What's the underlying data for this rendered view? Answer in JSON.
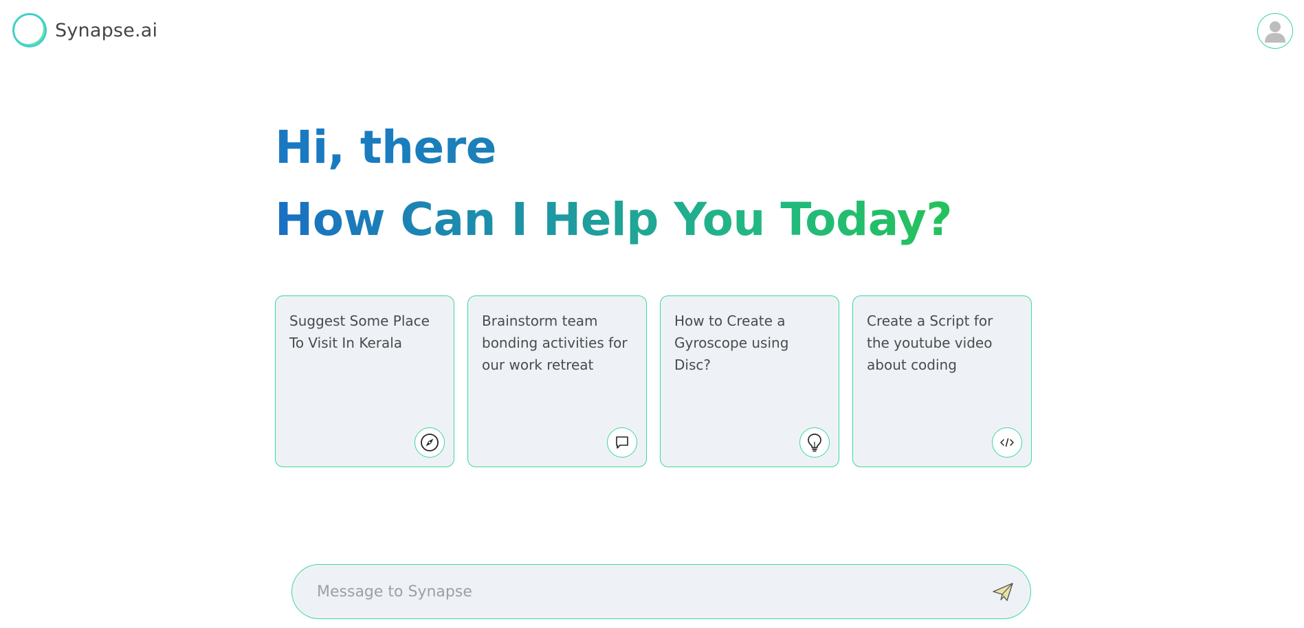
{
  "app": {
    "name": "Synapse.ai"
  },
  "greeting": {
    "line1": "Hi, there",
    "line2": "How Can I Help You Today?"
  },
  "suggestions": [
    {
      "text": "Suggest Some Place To Visit In Kerala",
      "icon": "compass-icon"
    },
    {
      "text": "Brainstorm team bonding activities for our work retreat",
      "icon": "chat-bubble-icon"
    },
    {
      "text": "How to Create a Gyroscope using Disc?",
      "icon": "lightbulb-icon"
    },
    {
      "text": "Create a Script for the youtube video about coding",
      "icon": "code-icon"
    }
  ],
  "composer": {
    "placeholder": "Message to Synapse",
    "value": ""
  },
  "colors": {
    "accent_border": "#3dd6a0",
    "card_bg": "#eef2f7",
    "gradient_start": "#1a6fc4",
    "gradient_end": "#24c25a"
  }
}
